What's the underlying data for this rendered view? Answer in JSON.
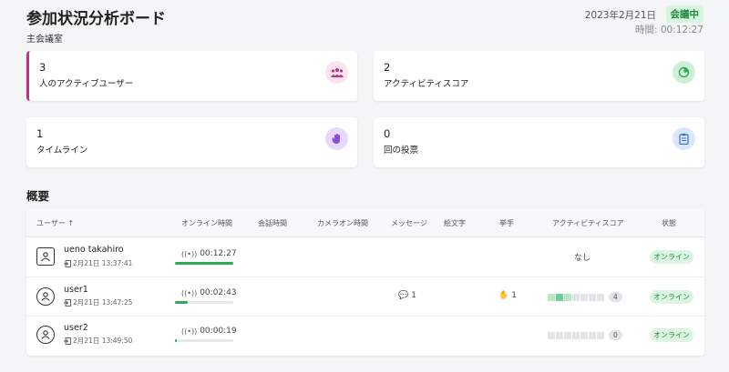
{
  "header": {
    "title": "参加状況分析ボード",
    "room": "主会議室",
    "date": "2023年2月21日",
    "status": "会議中",
    "elapsed": "時間: 00:12:27"
  },
  "cards": [
    {
      "number": "3",
      "label": "人のアクティブユーザー",
      "icon": "users-icon",
      "color": "#c2307e"
    },
    {
      "number": "2",
      "label": "アクティビティスコア",
      "icon": "pie-chart-icon",
      "color": "#2eaa52"
    },
    {
      "number": "1",
      "label": "タイムライン",
      "icon": "hand-icon",
      "color": "#8a4fd8"
    },
    {
      "number": "0",
      "label": "回の投票",
      "icon": "clipboard-icon",
      "color": "#3b6fd6"
    }
  ],
  "overview": {
    "title": "概要",
    "columns": [
      "ユーザー ↑",
      "オンライン時間",
      "会話時間",
      "カメラオン時間",
      "メッセージ",
      "絵文字",
      "挙手",
      "アクティビティスコア",
      "状態"
    ],
    "rows": [
      {
        "name": "ueno takahiro",
        "joined": "2月21日 13:37:41",
        "online": "00:12:27",
        "online_fraction": 1.0,
        "messages": "",
        "hands": "",
        "score_text": "なし",
        "status": "オンライン",
        "avatar": "host-avatar-icon"
      },
      {
        "name": "user1",
        "joined": "2月21日 13:47:25",
        "online": "00:02:43",
        "online_fraction": 0.22,
        "messages": "1",
        "hands": "1",
        "score": "4",
        "status": "オンライン",
        "avatar": "user-avatar-icon"
      },
      {
        "name": "user2",
        "joined": "2月21日 13:49:50",
        "online": "00:00:19",
        "online_fraction": 0.03,
        "messages": "",
        "hands": "",
        "score": "0",
        "status": "オンライン",
        "avatar": "user-avatar-icon"
      }
    ]
  },
  "colors": {
    "accent": "#c2307e",
    "online": "#2eaa52",
    "background": "#f4f5f7"
  }
}
